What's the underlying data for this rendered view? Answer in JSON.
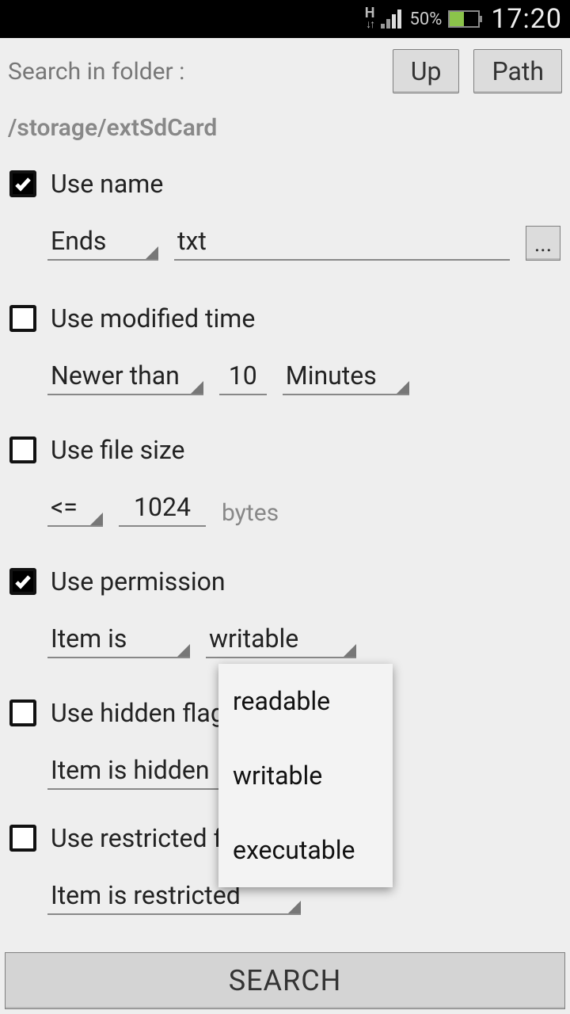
{
  "statusbar": {
    "network_label": "H",
    "battery_pct": "50%",
    "clock": "17:20"
  },
  "header": {
    "label": "Search in folder :",
    "up_btn": "Up",
    "path_btn": "Path"
  },
  "path": "/storage/extSdCard",
  "name_section": {
    "checkbox_label": "Use name",
    "checked": true,
    "mode": "Ends",
    "value": "txt",
    "more": "..."
  },
  "time_section": {
    "checkbox_label": "Use modified time",
    "checked": false,
    "mode": "Newer than",
    "value": "10",
    "unit": "Minutes"
  },
  "size_section": {
    "checkbox_label": "Use file size",
    "checked": false,
    "op": "<=",
    "value": "1024",
    "unit": "bytes"
  },
  "perm_section": {
    "checkbox_label": "Use permission",
    "checked": true,
    "mode": "Item is",
    "value": "writable"
  },
  "hidden_section": {
    "checkbox_label": "Use hidden flag",
    "checked": false,
    "mode": "Item is hidden"
  },
  "restricted_section": {
    "checkbox_label": "Use restricted flag",
    "checked": false,
    "mode": "Item is restricted"
  },
  "dropdown": {
    "options": [
      "readable",
      "writable",
      "executable"
    ]
  },
  "search_btn": "SEARCH"
}
